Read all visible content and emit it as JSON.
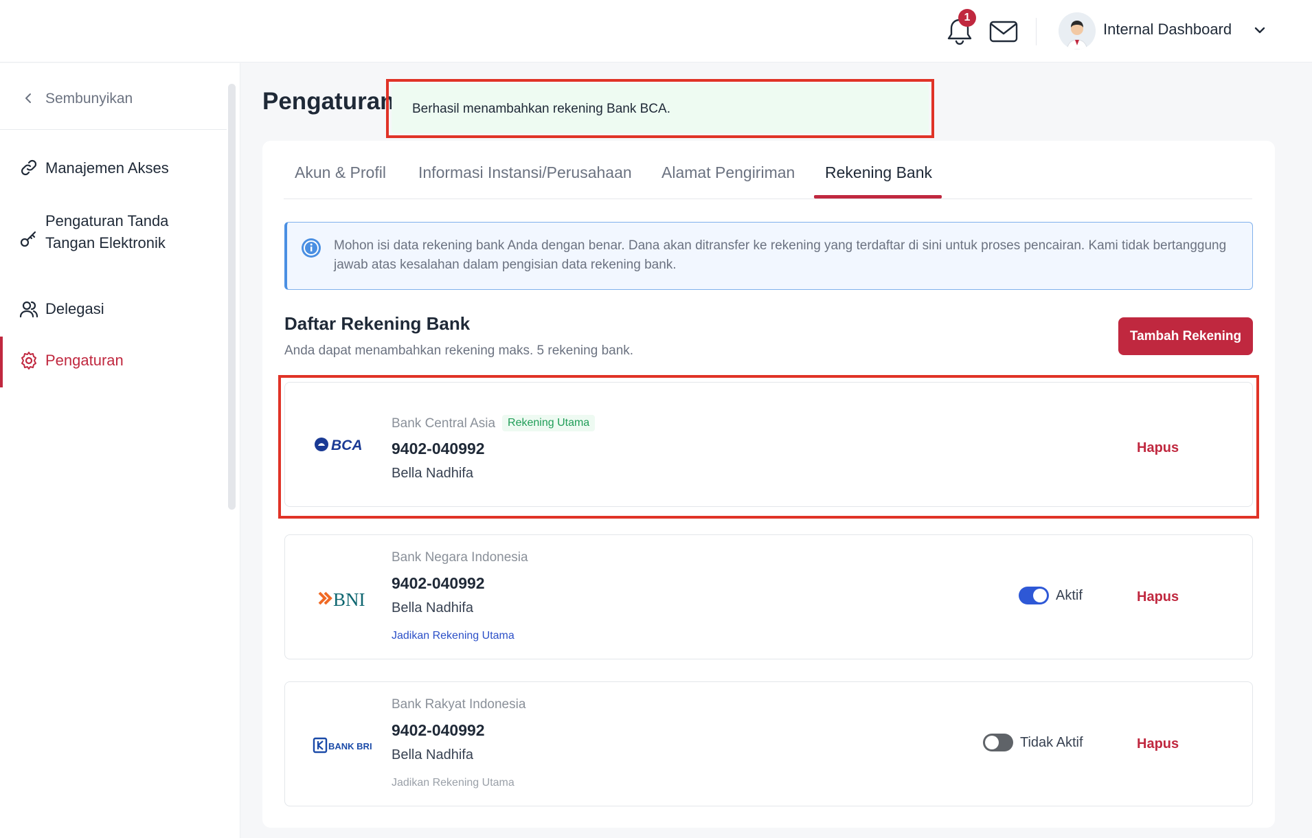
{
  "header": {
    "notification_count": "1",
    "user_name": "Internal Dashboard",
    "icons": [
      "bell-icon",
      "mail-icon",
      "avatar",
      "chevron-down-icon"
    ]
  },
  "sidebar": {
    "hide_label": "Sembunyikan",
    "items": [
      {
        "label": "Manajemen Akses",
        "icon": "link-icon",
        "active": false
      },
      {
        "label": "Pengaturan Tanda Tangan Elektronik",
        "icon": "key-icon",
        "active": false
      },
      {
        "label": "Delegasi",
        "icon": "users-icon",
        "active": false
      },
      {
        "label": "Pengaturan",
        "icon": "gear-icon",
        "active": true
      }
    ]
  },
  "page": {
    "title": "Pengaturan"
  },
  "toast": {
    "message": "Berhasil menambahkan rekening Bank BCA."
  },
  "tabs": [
    {
      "label": "Akun & Profil",
      "active": false
    },
    {
      "label": "Informasi Instansi/Perusahaan",
      "active": false
    },
    {
      "label": "Alamat Pengiriman",
      "active": false
    },
    {
      "label": "Rekening Bank",
      "active": true
    }
  ],
  "info_banner": {
    "text": "Mohon isi data rekening bank Anda dengan benar. Dana akan ditransfer ke rekening yang terdaftar di sini untuk proses pencairan. Kami tidak bertanggung jawab atas kesalahan dalam pengisian data rekening bank."
  },
  "bank_list": {
    "title": "Daftar Rekening Bank",
    "subtitle": "Anda dapat menambahkan rekening maks. 5 rekening bank.",
    "add_button": "Tambah Rekening",
    "accounts": [
      {
        "logo_text": "BCA",
        "bank_name": "Bank Central Asia",
        "badge": "Rekening Utama",
        "number": "9402-040992",
        "holder": "Bella Nadhifa",
        "delete": "Hapus"
      },
      {
        "logo_text": "BNI",
        "bank_name": "Bank Negara Indonesia",
        "number": "9402-040992",
        "holder": "Bella Nadhifa",
        "set_primary": "Jadikan Rekening Utama",
        "status": "Aktif",
        "active": true,
        "delete": "Hapus"
      },
      {
        "logo_text": "BANK BRI",
        "bank_name": "Bank Rakyat Indonesia",
        "number": "9402-040992",
        "holder": "Bella Nadhifa",
        "set_primary": "Jadikan Rekening Utama",
        "status": "Tidak Aktif",
        "active": false,
        "delete": "Hapus"
      }
    ]
  },
  "colors": {
    "accent": "#c0283f",
    "link": "#2b4fc7",
    "toggle_on": "#2e58d6",
    "success_bg": "#eefbf2",
    "highlight": "#e03327"
  }
}
